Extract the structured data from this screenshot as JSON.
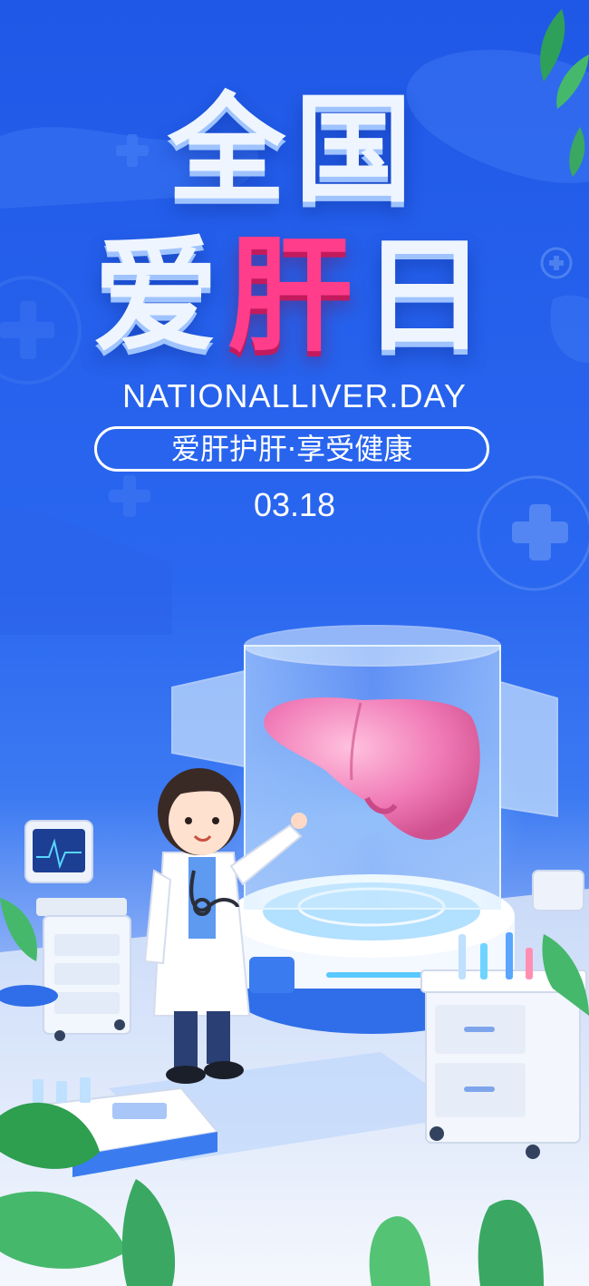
{
  "poster": {
    "title_line1": "全国",
    "title_line2_a": "爱",
    "title_line2_accent": "肝",
    "title_line2_b": "日",
    "subtitle": "NATIONALLIVER.DAY",
    "slogan": "爱肝护肝·享受健康",
    "date": "03.18"
  },
  "colors": {
    "background": "#2463ee",
    "title": "#eef5ff",
    "accent": "#ff3d8a",
    "liver": "#f07ab6"
  },
  "icons": [
    "plus-cross-icon",
    "plus-circle-icon",
    "leaf-icon"
  ]
}
